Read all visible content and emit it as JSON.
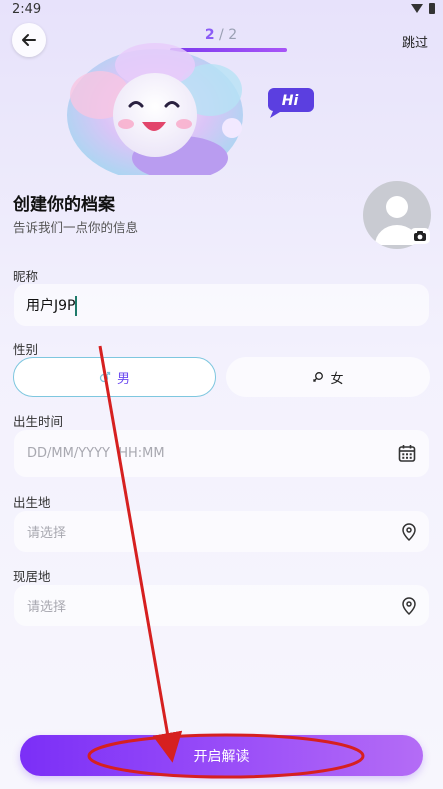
{
  "status_bar": {
    "time": "2:49",
    "icons": [
      "wifi-icon",
      "battery-icon"
    ]
  },
  "header": {
    "back_icon": "arrow-left-icon",
    "progress": {
      "current": "2",
      "separator": "/",
      "total": "2",
      "fraction": 1.0
    },
    "skip_label": "跳过"
  },
  "hero": {
    "bubble_text": "Hi"
  },
  "profile": {
    "title": "创建你的档案",
    "subtitle": "告诉我们一点你的信息",
    "avatar_icon": "person-silhouette-icon",
    "camera_icon": "camera-icon"
  },
  "form": {
    "nickname": {
      "label": "昵称",
      "value": "用户J9P"
    },
    "gender": {
      "label": "性别",
      "male_label": "男",
      "female_label": "女",
      "selected": "男",
      "male_icon": "male-symbol-icon",
      "female_icon": "female-symbol-icon"
    },
    "birth_time": {
      "label": "出生时间",
      "placeholder": "DD/MM/YYYY  HH:MM",
      "icon": "calendar-icon"
    },
    "birth_place": {
      "label": "出生地",
      "placeholder": "请选择",
      "icon": "location-pin-icon"
    },
    "current_place": {
      "label": "现居地",
      "placeholder": "请选择",
      "icon": "location-pin-icon"
    }
  },
  "footer": {
    "start_label": "开启解读"
  },
  "colors": {
    "accent": "#8b5cf6",
    "button_start": "#7b2ff7",
    "button_end": "#b46cf6",
    "annotation": "#d62020"
  }
}
